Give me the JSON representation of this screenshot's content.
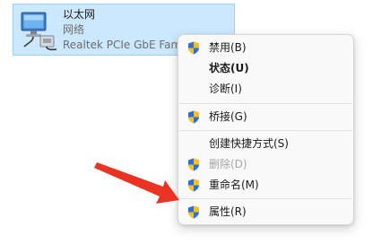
{
  "adapter": {
    "name": "以太网",
    "status": "网络",
    "device": "Realtek PCIe GbE Family Controller",
    "icon": "network-adapter-icon"
  },
  "menu": {
    "items": [
      {
        "label": "禁用(B)",
        "icon": "uac-shield-icon",
        "bold": false,
        "disabled": false
      },
      {
        "label": "状态(U)",
        "icon": "",
        "bold": true,
        "disabled": false
      },
      {
        "label": "诊断(I)",
        "icon": "",
        "bold": false,
        "disabled": false
      },
      {
        "label": "桥接(G)",
        "icon": "uac-shield-icon",
        "bold": false,
        "disabled": false
      },
      {
        "label": "创建快捷方式(S)",
        "icon": "",
        "bold": false,
        "disabled": false
      },
      {
        "label": "删除(D)",
        "icon": "uac-shield-icon",
        "bold": false,
        "disabled": true
      },
      {
        "label": "重命名(M)",
        "icon": "uac-shield-icon",
        "bold": false,
        "disabled": false
      },
      {
        "label": "属性(R)",
        "icon": "uac-shield-icon",
        "bold": false,
        "disabled": false
      }
    ]
  },
  "annotation": {
    "arrow_color": "#ea3323",
    "points_to": "属性(R)"
  },
  "colors": {
    "selection_bg": "#cce8ff",
    "selection_border": "#99d1ff",
    "menu_bg": "#f9f9f9",
    "shield_blue": "#2b6fd6",
    "shield_yellow": "#f5c21b"
  }
}
